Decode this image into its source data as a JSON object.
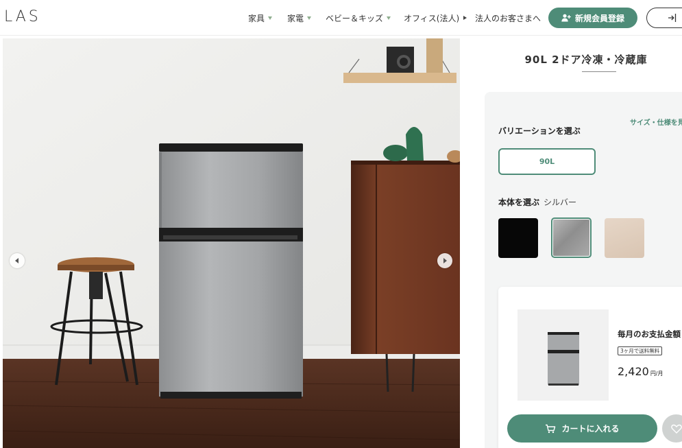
{
  "header": {
    "logo": "LAS",
    "nav": [
      {
        "label": "家具",
        "marker": "down"
      },
      {
        "label": "家電",
        "marker": "down"
      },
      {
        "label": "ベビー＆キッズ",
        "marker": "down"
      },
      {
        "label": "オフィス(法人)",
        "marker": "right"
      },
      {
        "label": "法人のお客さまへ",
        "marker": "none"
      }
    ],
    "register_label": "新規会員登録",
    "register_icon": "person-add-icon",
    "login_icon": "login-arrow-icon"
  },
  "gallery": {
    "prev_icon": "chevron-left-icon",
    "next_icon": "chevron-right-icon"
  },
  "product": {
    "title": "90L 2ドア冷凍・冷蔵庫",
    "size_link": "サイズ・仕様を見",
    "variation_label": "バリエーションを選ぶ",
    "variation_selected": "90L",
    "body_label": "本体を選ぶ",
    "body_selected": "シルバー",
    "swatches": [
      {
        "name": "black",
        "color": "#070707"
      },
      {
        "name": "silver",
        "color": "#a0a0a0",
        "selected": true
      },
      {
        "name": "wood",
        "color": "#decbb9"
      }
    ]
  },
  "purchase": {
    "monthly_label": "毎月のお支払金額",
    "shipping_badge": "3ヶ月で送料無料",
    "price": "2,420",
    "price_unit": "円/月",
    "cart_label": "カートに入れる",
    "cart_icon": "cart-icon",
    "fav_icon": "heart-icon"
  },
  "colors": {
    "accent": "#4e8c78",
    "panel_bg": "#f4f5f5"
  }
}
